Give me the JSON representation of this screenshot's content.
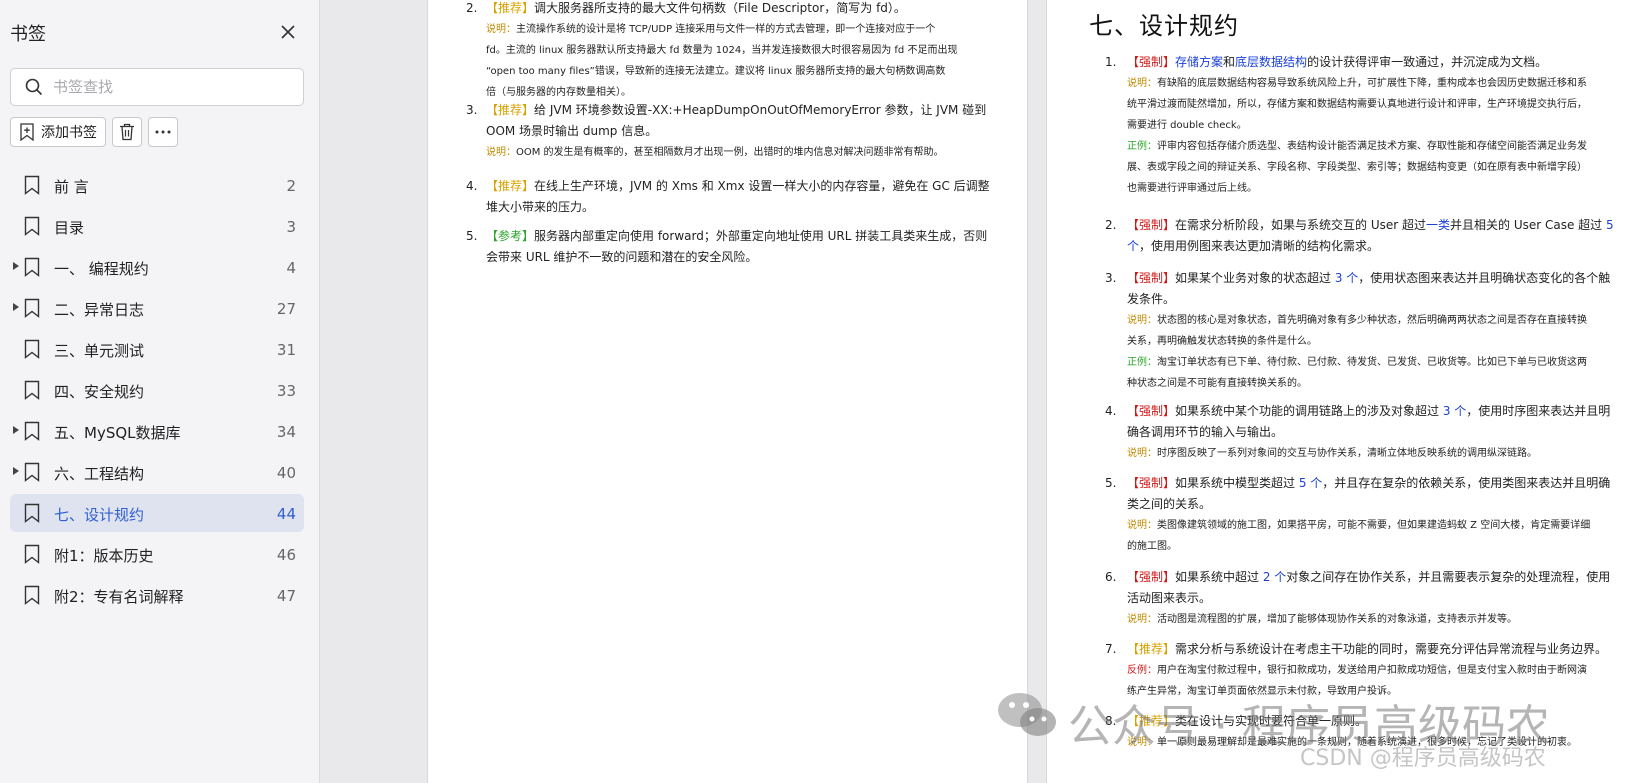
{
  "sidebar": {
    "title": "书签",
    "search_placeholder": "书签查找",
    "add_label": "添加书签",
    "items": [
      {
        "label": "前 言",
        "page": "2",
        "expandable": false,
        "active": false
      },
      {
        "label": "目录",
        "page": "3",
        "expandable": false,
        "active": false
      },
      {
        "label": "一、 编程规约",
        "page": "4",
        "expandable": true,
        "active": false
      },
      {
        "label": "二、异常日志",
        "page": "27",
        "expandable": true,
        "active": false
      },
      {
        "label": "三、单元测试",
        "page": "31",
        "expandable": false,
        "active": false
      },
      {
        "label": "四、安全规约",
        "page": "33",
        "expandable": false,
        "active": false
      },
      {
        "label": "五、MySQL数据库",
        "page": "34",
        "expandable": true,
        "active": false
      },
      {
        "label": "六、工程结构",
        "page": "40",
        "expandable": true,
        "active": false
      },
      {
        "label": "七、设计规约",
        "page": "44",
        "expandable": false,
        "active": true
      },
      {
        "label": "附1：版本历史",
        "page": "46",
        "expandable": false,
        "active": false
      },
      {
        "label": "附2：专有名词解释",
        "page": "47",
        "expandable": false,
        "active": false
      }
    ]
  },
  "left_page": {
    "items": [
      {
        "num": "2.",
        "tag": "【推荐】",
        "text": "调大服务器所支持的最大文件句柄数（File Descriptor，简写为 fd）。",
        "note_label": "说明：",
        "note": [
          "主流操作系统的设计是将 TCP/UDP 连接采用与文件一样的方式去管理，即一个连接对应于一个",
          "fd。主流的 linux 服务器默认所支持最大 fd 数量为 1024，当并发连接数很大时很容易因为 fd 不足而出现",
          "“open too many files”错误，导致新的连接无法建立。建议将 linux 服务器所支持的最大句柄数调高数",
          "倍（与服务器的内存数量相关）。"
        ]
      },
      {
        "num": "3.",
        "tag": "【推荐】",
        "text": [
          "给 JVM 环境参数设置-XX:+HeapDumpOnOutOfMemoryError 参数，让 JVM 碰到",
          "OOM 场景时输出 dump 信息。"
        ],
        "note_label": "说明：",
        "note": [
          "OOM 的发生是有概率的，甚至相隔数月才出现一例，出错时的堆内信息对解决问题非常有帮助。"
        ]
      },
      {
        "num": "4.",
        "tag": "【推荐】",
        "text": [
          "在线上生产环境，JVM 的 Xms 和 Xmx 设置一样大小的内存容量，避免在 GC 后调整",
          "堆大小带来的压力。"
        ]
      },
      {
        "num": "5.",
        "tag": "【参考】",
        "text": [
          "服务器内部重定向使用 forward；外部重定向地址使用 URL 拼装工具类来生成，否则",
          "会带来 URL 维护不一致的问题和潜在的安全风险。"
        ]
      }
    ]
  },
  "right_page": {
    "heading": "七、设计规约",
    "item1": {
      "num": "1.",
      "tag": "【强制】",
      "link1": "存储方案",
      "and": "和",
      "link2": "底层数据结构",
      "rest": "的设计获得评审一致通过，并沉淀成为文档。",
      "note_label": "说明：",
      "note": [
        "有缺陷的底层数据结构容易导致系统风险上升，可扩展性下降，重构成本也会因历史数据迁移和系",
        "统平滑过渡而陡然增加，所以，存储方案和数据结构需要认真地进行设计和评审，生产环境提交执行后，",
        "需要进行 double check。"
      ],
      "good_label": "正例：",
      "good": [
        "评审内容包括存储介质选型、表结构设计能否满足技术方案、存取性能和存储空间能否满足业务发",
        "展、表或字段之间的辩证关系、字段名称、字段类型、索引等；数据结构变更（如在原有表中新增字段）",
        "也需要进行评审通过后上线。"
      ]
    },
    "item2": {
      "num": "2.",
      "tag": "【强制】",
      "a": "在需求分析阶段，如果与系统交互的 User 超过",
      "b": "一类",
      "c": "并且相关的 User Case 超过 ",
      "d": "5",
      "e": "个",
      "f": "，使用用例图来表达更加清晰的结构化需求。"
    },
    "item3": {
      "num": "3.",
      "tag": "【强制】",
      "a": "如果某个业务对象的状态超过 ",
      "b": "3 个",
      "c": "，使用状态图来表达并且明确状态变化的各个触",
      "d": "发条件。",
      "note_label": "说明：",
      "note": [
        "状态图的核心是对象状态，首先明确对象有多少种状态，然后明确两两状态之间是否存在直接转换",
        "关系，再明确触发状态转换的条件是什么。"
      ],
      "good_label": "正例：",
      "good": [
        "淘宝订单状态有已下单、待付款、已付款、待发货、已发货、已收货等。比如已下单与已收货这两",
        "种状态之间是不可能有直接转换关系的。"
      ]
    },
    "item4": {
      "num": "4.",
      "tag": "【强制】",
      "a": "如果系统中某个功能的调用链路上的涉及对象超过 ",
      "b": "3 个",
      "c": "，使用时序图来表达并且明",
      "d": "确各调用环节的输入与输出。",
      "note_label": "说明：",
      "note": [
        "时序图反映了一系列对象间的交互与协作关系，清晰立体地反映系统的调用纵深链路。"
      ]
    },
    "item5": {
      "num": "5.",
      "tag": "【强制】",
      "a": "如果系统中模型类超过 ",
      "b": "5 个",
      "c": "，并且存在复杂的依赖关系，使用类图来表达并且明确",
      "d": "类之间的关系。",
      "note_label": "说明：",
      "note": [
        "类图像建筑领域的施工图，如果搭平房，可能不需要，但如果建造蚂蚁 Z 空间大楼，肯定需要详细",
        "的施工图。"
      ]
    },
    "item6": {
      "num": "6.",
      "tag": "【强制】",
      "a": "如果系统中超过 ",
      "b": "2 个",
      "c": "对象之间存在协作关系，并且需要表示复杂的处理流程，使用",
      "d": "活动图来表示。",
      "note_label": "说明：",
      "note": [
        "活动图是流程图的扩展，增加了能够体现协作关系的对象泳道，支持表示并发等。"
      ]
    },
    "item7": {
      "num": "7.",
      "tag": "【推荐】",
      "a": "需求分析与系统设计在考虑主干功能的同时，需要充分评估异常流程与业务边界。",
      "bad_label": "反例：",
      "bad": [
        "用户在淘宝付款过程中，银行扣款成功，发送给用户扣款成功短信，但是支付宝入款时由于断网演",
        "练产生异常，淘宝订单页面依然显示未付款，导致用户投诉。"
      ]
    },
    "item8": {
      "num": "8.",
      "tag": "【推荐】",
      "a": "类在设计与实现时要符合单一原则。",
      "note_label": "说明：",
      "note": [
        "单一原则最易理解却是最难实施的一条规则，随着系统演进，很多时候，忘记了类设计的初衷。"
      ]
    }
  },
  "watermark": {
    "line1": "公众号 · 程序员高级码农",
    "line2": "CSDN @程序员高级码农"
  }
}
